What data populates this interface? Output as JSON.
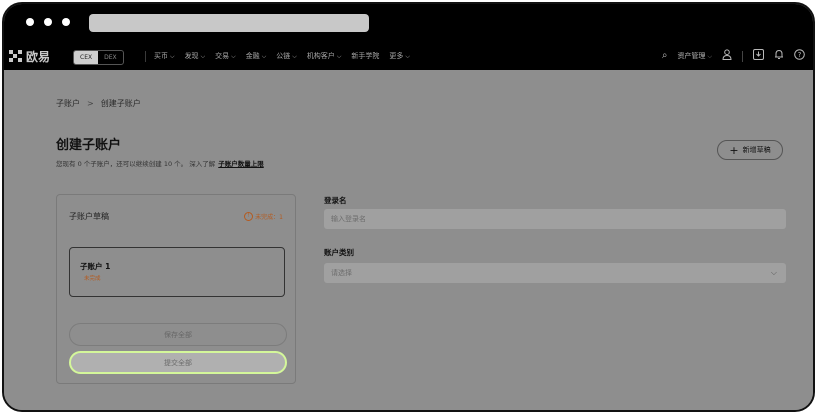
{
  "browser": {
    "url": ""
  },
  "nav": {
    "logo_text": "欧易",
    "segment": {
      "cex": "CEX",
      "dex": "DEX"
    },
    "menu": [
      {
        "label": "买币"
      },
      {
        "label": "发现"
      },
      {
        "label": "交易"
      },
      {
        "label": "金融"
      },
      {
        "label": "公链"
      },
      {
        "label": "机构客户"
      },
      {
        "label": "新手学院",
        "no_chevron": true
      },
      {
        "label": "更多"
      }
    ],
    "asset_management": "资产管理"
  },
  "breadcrumb": {
    "parent": "子账户",
    "separator": ">",
    "current": "创建子账户"
  },
  "page": {
    "title": "创建子账户",
    "subtitle": "您现有 0 个子账户，还可以继续创建 10 个。 深入了解",
    "subtitle_link": "子账户数量上限",
    "new_draft_label": "新增草稿"
  },
  "drafts_panel": {
    "title": "子账户草稿",
    "status_badge": "未完成：1",
    "draft_card": {
      "name": "子账户 1",
      "status": "未完成"
    },
    "save_all_label": "保存全部",
    "submit_all_label": "提交全部"
  },
  "form": {
    "login_name_label": "登录名",
    "login_name_placeholder": "输入登录名",
    "account_type_label": "账户类别",
    "account_type_placeholder": "请选择"
  },
  "colors": {
    "overlay_bg": "#8e8e8e",
    "nav_bg": "#000000",
    "warning": "#b55a1e",
    "submit_border": "#d4f79a"
  }
}
